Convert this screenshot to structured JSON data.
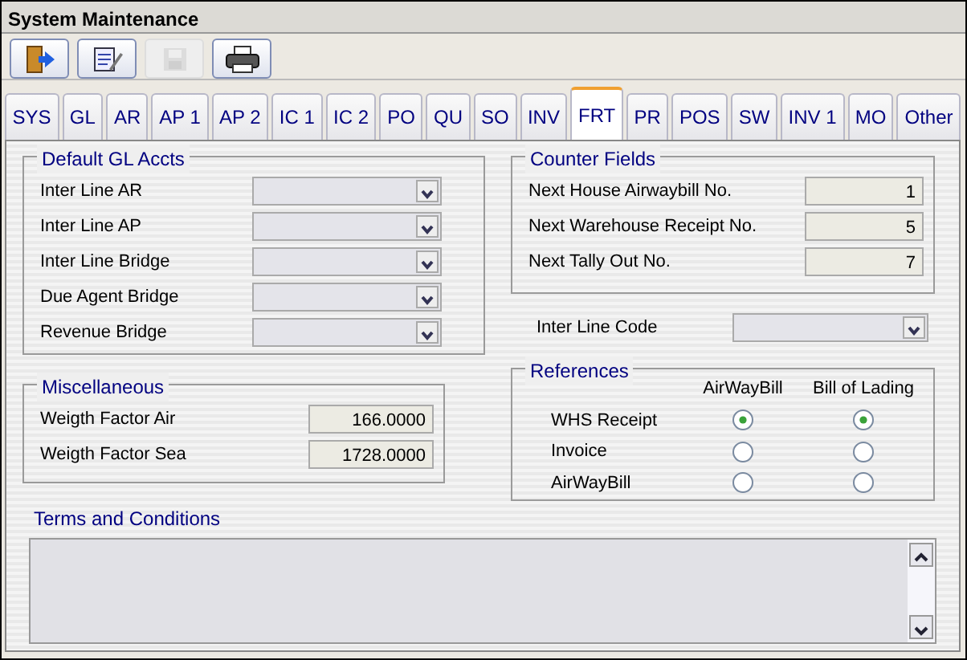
{
  "window": {
    "title": "System Maintenance"
  },
  "toolbar": [
    {
      "kind": "exit",
      "disabled": false
    },
    {
      "kind": "edit",
      "disabled": false
    },
    {
      "kind": "save",
      "disabled": true
    },
    {
      "kind": "print",
      "disabled": false
    }
  ],
  "tabs": [
    {
      "label": "SYS",
      "selected": false
    },
    {
      "label": "GL",
      "selected": false
    },
    {
      "label": "AR",
      "selected": false
    },
    {
      "label": "AP 1",
      "selected": false
    },
    {
      "label": "AP 2",
      "selected": false
    },
    {
      "label": "IC 1",
      "selected": false
    },
    {
      "label": "IC 2",
      "selected": false
    },
    {
      "label": "PO",
      "selected": false
    },
    {
      "label": "QU",
      "selected": false
    },
    {
      "label": "SO",
      "selected": false
    },
    {
      "label": "INV",
      "selected": false
    },
    {
      "label": "FRT",
      "selected": true
    },
    {
      "label": "PR",
      "selected": false
    },
    {
      "label": "POS",
      "selected": false
    },
    {
      "label": "SW",
      "selected": false
    },
    {
      "label": "INV 1",
      "selected": false
    },
    {
      "label": "MO",
      "selected": false
    },
    {
      "label": "Other",
      "selected": false
    }
  ],
  "default_gl_accts": {
    "title": "Default  GL Accts",
    "fields": [
      {
        "label": "Inter Line AR"
      },
      {
        "label": "Inter Line AP"
      },
      {
        "label": "Inter Line Bridge"
      },
      {
        "label": "Due Agent Bridge"
      },
      {
        "label": "Revenue Bridge"
      }
    ]
  },
  "miscellaneous": {
    "title": "Miscellaneous",
    "fields": [
      {
        "label": "Weigth Factor Air",
        "value": "166.0000"
      },
      {
        "label": "Weigth Factor Sea",
        "value": "1728.0000"
      }
    ]
  },
  "counter_fields": {
    "title": "Counter Fields",
    "fields": [
      {
        "label": "Next House Airwaybill No.",
        "value": "1"
      },
      {
        "label": "Next Warehouse Receipt No.",
        "value": "5"
      },
      {
        "label": "Next Tally Out No.",
        "value": "7"
      }
    ]
  },
  "inter_line_code": {
    "label": "Inter Line Code"
  },
  "references": {
    "title": "References",
    "columns": [
      "AirWayBill",
      "Bill of Lading"
    ],
    "rows": [
      {
        "label": "WHS Receipt",
        "options": [
          {
            "selected": true
          },
          {
            "selected": true
          }
        ]
      },
      {
        "label": "Invoice",
        "options": [
          {
            "selected": false
          },
          {
            "selected": false
          }
        ]
      },
      {
        "label": "AirWayBill",
        "options": [
          {
            "selected": false
          },
          {
            "selected": false
          }
        ]
      }
    ]
  },
  "terms": {
    "label": "Terms and Conditions"
  }
}
